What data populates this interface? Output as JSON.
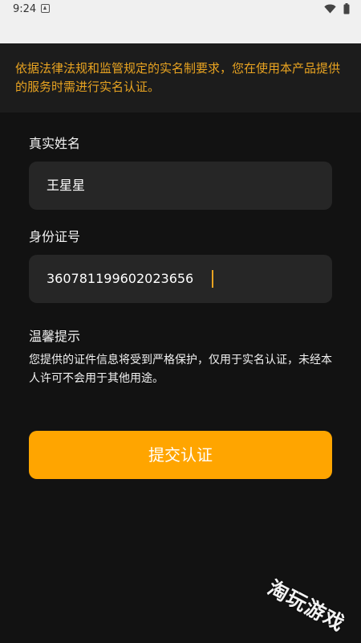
{
  "status_bar": {
    "time": "9:24",
    "icons": [
      "notification-icon",
      "wifi-icon",
      "battery-icon"
    ]
  },
  "notice": {
    "text": "依据法律法规和监管规定的实名制要求，您在使用本产品提供的服务时需进行实名认证。",
    "color": "#e8a321"
  },
  "form": {
    "name_label": "真实姓名",
    "name_value": "王星星",
    "id_label": "身份证号",
    "id_value": "360781199602023656"
  },
  "tips": {
    "title": "温馨提示",
    "body": "您提供的证件信息将受到严格保护，仅用于实名认证，未经本人许可不会用于其他用途。"
  },
  "submit": {
    "label": "提交认证",
    "color": "#ffa500"
  },
  "watermark": {
    "text": "淘玩游戏"
  }
}
